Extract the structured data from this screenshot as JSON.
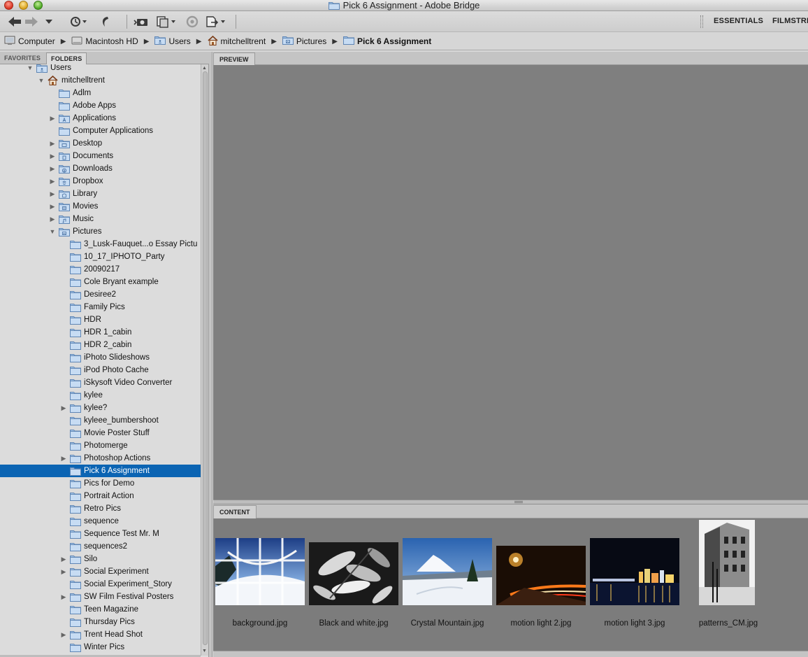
{
  "window": {
    "title": "Pick 6 Assignment - Adobe Bridge"
  },
  "toolbar": {
    "workspaces": [
      "ESSENTIALS",
      "FILMSTRI"
    ]
  },
  "path": [
    {
      "label": "Computer",
      "icon": "computer-icon"
    },
    {
      "label": "Macintosh HD",
      "icon": "hard-drive-icon"
    },
    {
      "label": "Users",
      "icon": "users-folder-icon"
    },
    {
      "label": "mitchelltrent",
      "icon": "home-icon"
    },
    {
      "label": "Pictures",
      "icon": "pictures-folder-icon"
    },
    {
      "label": "Pick 6 Assignment",
      "icon": "folder-icon"
    }
  ],
  "left_panel": {
    "tabs": [
      "FAVORITES",
      "FOLDERS"
    ],
    "active_tab": "FOLDERS",
    "tree": [
      {
        "label": "Users",
        "level": 0,
        "expander": "open",
        "icon": "users-folder-icon"
      },
      {
        "label": "mitchelltrent",
        "level": 1,
        "expander": "open",
        "icon": "home-icon"
      },
      {
        "label": "Adlm",
        "level": 2,
        "expander": "none",
        "icon": "folder-icon"
      },
      {
        "label": "Adobe Apps",
        "level": 2,
        "expander": "none",
        "icon": "folder-icon"
      },
      {
        "label": "Applications",
        "level": 2,
        "expander": "closed",
        "icon": "applications-folder-icon"
      },
      {
        "label": "Computer Applications",
        "level": 2,
        "expander": "none",
        "icon": "folder-icon"
      },
      {
        "label": "Desktop",
        "level": 2,
        "expander": "closed",
        "icon": "desktop-folder-icon"
      },
      {
        "label": "Documents",
        "level": 2,
        "expander": "closed",
        "icon": "documents-folder-icon"
      },
      {
        "label": "Downloads",
        "level": 2,
        "expander": "closed",
        "icon": "downloads-folder-icon"
      },
      {
        "label": "Dropbox",
        "level": 2,
        "expander": "closed",
        "icon": "dropbox-folder-icon"
      },
      {
        "label": "Library",
        "level": 2,
        "expander": "closed",
        "icon": "library-folder-icon"
      },
      {
        "label": "Movies",
        "level": 2,
        "expander": "closed",
        "icon": "movies-folder-icon"
      },
      {
        "label": "Music",
        "level": 2,
        "expander": "closed",
        "icon": "music-folder-icon"
      },
      {
        "label": "Pictures",
        "level": 2,
        "expander": "open",
        "icon": "pictures-folder-icon"
      },
      {
        "label": "3_Lusk-Fauquet...o Essay Pictu",
        "level": 3,
        "expander": "none",
        "icon": "folder-icon"
      },
      {
        "label": "10_17_IPHOTO_Party",
        "level": 3,
        "expander": "none",
        "icon": "folder-icon"
      },
      {
        "label": "20090217",
        "level": 3,
        "expander": "none",
        "icon": "folder-icon"
      },
      {
        "label": "Cole Bryant example",
        "level": 3,
        "expander": "none",
        "icon": "folder-icon"
      },
      {
        "label": "Desiree2",
        "level": 3,
        "expander": "none",
        "icon": "folder-icon"
      },
      {
        "label": "Family Pics",
        "level": 3,
        "expander": "none",
        "icon": "folder-icon"
      },
      {
        "label": "HDR",
        "level": 3,
        "expander": "none",
        "icon": "folder-icon"
      },
      {
        "label": "HDR 1_cabin",
        "level": 3,
        "expander": "none",
        "icon": "folder-icon"
      },
      {
        "label": "HDR 2_cabin",
        "level": 3,
        "expander": "none",
        "icon": "folder-icon"
      },
      {
        "label": "iPhoto Slideshows",
        "level": 3,
        "expander": "none",
        "icon": "folder-icon"
      },
      {
        "label": "iPod Photo Cache",
        "level": 3,
        "expander": "none",
        "icon": "folder-icon"
      },
      {
        "label": "iSkysoft Video Converter",
        "level": 3,
        "expander": "none",
        "icon": "folder-icon"
      },
      {
        "label": "kylee",
        "level": 3,
        "expander": "none",
        "icon": "folder-icon"
      },
      {
        "label": "kylee?",
        "level": 3,
        "expander": "closed",
        "icon": "folder-icon"
      },
      {
        "label": "kyleee_bumbershoot",
        "level": 3,
        "expander": "none",
        "icon": "folder-icon"
      },
      {
        "label": "Movie Poster Stuff",
        "level": 3,
        "expander": "none",
        "icon": "folder-icon"
      },
      {
        "label": "Photomerge",
        "level": 3,
        "expander": "none",
        "icon": "folder-icon"
      },
      {
        "label": "Photoshop Actions",
        "level": 3,
        "expander": "closed",
        "icon": "folder-icon"
      },
      {
        "label": "Pick 6 Assignment",
        "level": 3,
        "expander": "none",
        "icon": "folder-icon",
        "selected": true
      },
      {
        "label": "Pics for Demo",
        "level": 3,
        "expander": "none",
        "icon": "folder-icon"
      },
      {
        "label": "Portrait Action",
        "level": 3,
        "expander": "none",
        "icon": "folder-icon"
      },
      {
        "label": "Retro Pics",
        "level": 3,
        "expander": "none",
        "icon": "folder-icon"
      },
      {
        "label": "sequence",
        "level": 3,
        "expander": "none",
        "icon": "folder-icon"
      },
      {
        "label": "Sequence Test Mr. M",
        "level": 3,
        "expander": "none",
        "icon": "folder-icon"
      },
      {
        "label": "sequences2",
        "level": 3,
        "expander": "none",
        "icon": "folder-icon"
      },
      {
        "label": "Silo",
        "level": 3,
        "expander": "closed",
        "icon": "folder-icon"
      },
      {
        "label": "Social Experiment",
        "level": 3,
        "expander": "closed",
        "icon": "folder-icon"
      },
      {
        "label": "Social Experiment_Story",
        "level": 3,
        "expander": "none",
        "icon": "folder-icon"
      },
      {
        "label": "SW Film Festival Posters",
        "level": 3,
        "expander": "closed",
        "icon": "folder-icon"
      },
      {
        "label": "Teen Magazine",
        "level": 3,
        "expander": "none",
        "icon": "folder-icon"
      },
      {
        "label": "Thursday Pics",
        "level": 3,
        "expander": "none",
        "icon": "folder-icon"
      },
      {
        "label": "Trent Head Shot",
        "level": 3,
        "expander": "closed",
        "icon": "folder-icon"
      },
      {
        "label": "Winter Pics",
        "level": 3,
        "expander": "none",
        "icon": "folder-icon"
      }
    ]
  },
  "preview": {
    "tab": "PREVIEW"
  },
  "content": {
    "tab": "CONTENT",
    "thumbnails": [
      {
        "file": "background.jpg",
        "subject": "snowy-panorama-grid",
        "orientation": "landscape"
      },
      {
        "file": "Black and white.jpg",
        "subject": "bw-leaves",
        "orientation": "landscape"
      },
      {
        "file": "Crystal Mountain.jpg",
        "subject": "snow-mountain",
        "orientation": "landscape"
      },
      {
        "file": "motion light 2.jpg",
        "subject": "light-trails",
        "orientation": "landscape"
      },
      {
        "file": "motion light 3.jpg",
        "subject": "city-night-skyline",
        "orientation": "landscape"
      },
      {
        "file": "patterns_CM.jpg",
        "subject": "bw-building",
        "orientation": "portrait"
      }
    ]
  },
  "colors": {
    "selection": "#0b64b3",
    "preview_bg": "#7f7f7f",
    "content_bg": "#7c7c7c",
    "panel_bg": "#dcdcdc"
  }
}
